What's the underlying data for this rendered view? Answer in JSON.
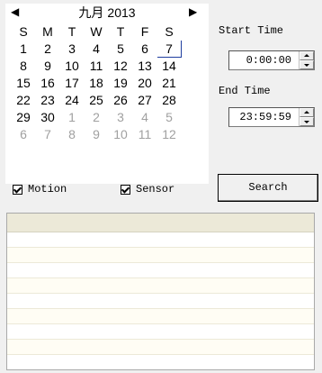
{
  "calendar": {
    "month": "九月",
    "year": "2013",
    "prev_glyph": "◀",
    "next_glyph": "▶",
    "weekdays": [
      "S",
      "M",
      "T",
      "W",
      "T",
      "F",
      "S"
    ],
    "weeks": [
      [
        "1",
        "2",
        "3",
        "4",
        "5",
        "6",
        "7"
      ],
      [
        "8",
        "9",
        "10",
        "11",
        "12",
        "13",
        "14"
      ],
      [
        "15",
        "16",
        "17",
        "18",
        "19",
        "20",
        "21"
      ],
      [
        "22",
        "23",
        "24",
        "25",
        "26",
        "27",
        "28"
      ],
      [
        "29",
        "30",
        "1",
        "2",
        "3",
        "4",
        "5"
      ],
      [
        "6",
        "7",
        "8",
        "9",
        "10",
        "11",
        "12"
      ]
    ],
    "selected_day": "7"
  },
  "start_time": {
    "label": "Start Time",
    "value": "0:00:00"
  },
  "end_time": {
    "label": "End Time",
    "value": "23:59:59"
  },
  "filters": {
    "motion": {
      "label": "Motion",
      "checked": true
    },
    "sensor": {
      "label": "Sensor",
      "checked": true
    }
  },
  "search_button": {
    "label": "Search"
  }
}
